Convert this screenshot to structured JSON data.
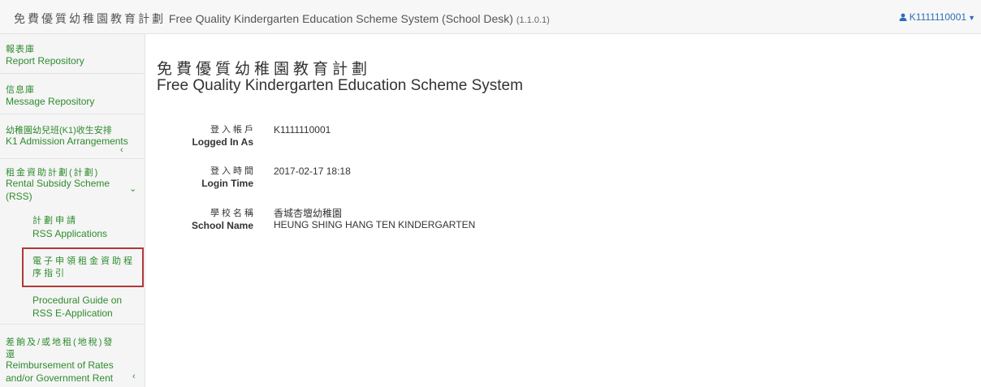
{
  "header": {
    "title_zh": "免費優質幼稚園教育計劃",
    "title_en": "Free Quality Kindergarten Education Scheme System (School Desk)",
    "version": "(1.1.0.1)",
    "user_label": "K1111110001",
    "user_icon": "user-icon",
    "caret_icon": "caret-down-icon"
  },
  "sidebar": {
    "items": [
      {
        "zh": "報表庫",
        "en": "Report Repository"
      },
      {
        "zh": "信息庫",
        "en": "Message Repository"
      },
      {
        "zh": "幼稚園幼兒班(K1)收生安排",
        "en": "K1 Admission Arrangements"
      },
      {
        "zh": "租金資助計劃(計劃)",
        "en1": "Rental Subsidy Scheme",
        "en2": "(RSS)"
      },
      {
        "zh1": "差餉及/或地租(地稅)發",
        "zh2": "還",
        "en1": "Reimbursement of Rates",
        "en2": "and/or Government Rent"
      }
    ],
    "sub_items": [
      {
        "zh": "計劃申請",
        "en": "RSS Applications"
      },
      {
        "zh1": "電子申領租金資助程",
        "zh2": "序指引"
      },
      {
        "en1": "Procedural Guide on",
        "en2": "RSS E-Application"
      }
    ],
    "chevron_left": "‹",
    "chevron_down": "⌄"
  },
  "main": {
    "title_zh": "免費優質幼稚園教育計劃",
    "title_en": "Free Quality Kindergarten Education Scheme System",
    "info": [
      {
        "label_zh": "登入帳戶",
        "label_en": "Logged In As",
        "value": "K1111110001"
      },
      {
        "label_zh": "登入時間",
        "label_en": "Login Time",
        "value": "2017-02-17 18:18"
      },
      {
        "label_zh": "學校名稱",
        "label_en": "School Name",
        "value_zh": "香城杏壇幼稚園",
        "value_en": "HEUNG SHING HANG TEN KINDERGARTEN"
      }
    ]
  },
  "colors": {
    "accent_green": "#2e8b2e",
    "link_blue": "#2a6ebb",
    "highlight_red": "#b03838"
  }
}
